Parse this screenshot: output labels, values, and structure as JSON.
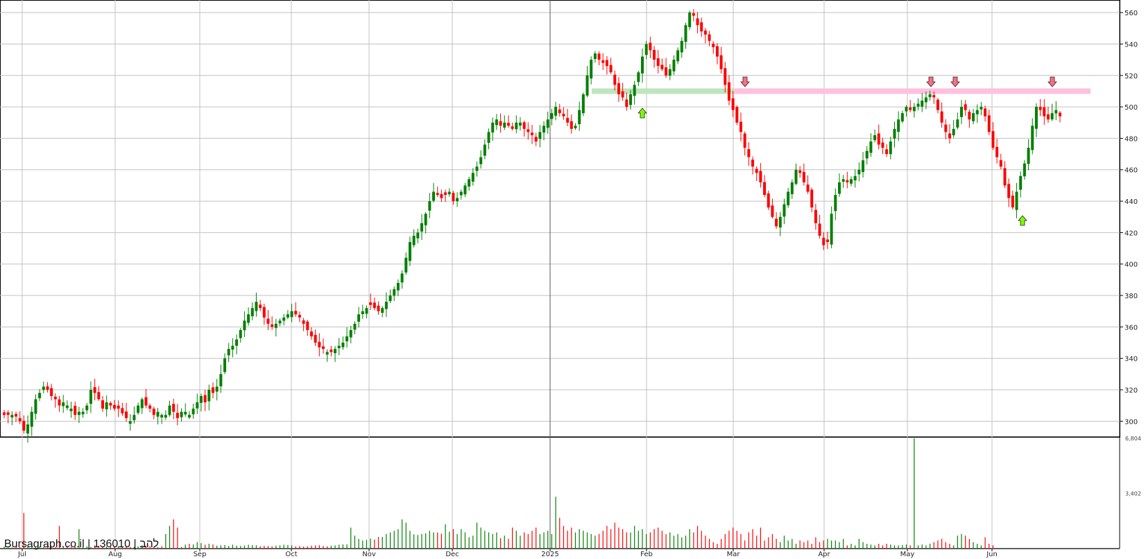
{
  "watermark": "Bursagraph.co.il | 136010 | להב",
  "colors": {
    "up": "#008000",
    "down": "#ff0000",
    "grid": "#c0c0c0",
    "support": "#bfe5bf",
    "resistance": "#ffc0e0",
    "up_arrow": "#7cfc00",
    "down_arrow": "#ff6e86"
  },
  "chart_data": [
    {
      "type": "candlestick",
      "title": "",
      "xlabel": "",
      "ylabel": "",
      "ylim": [
        290,
        568
      ],
      "y_ticks": [
        300,
        320,
        340,
        360,
        380,
        400,
        420,
        440,
        460,
        480,
        500,
        520,
        540,
        560
      ],
      "x_tick_labels": [
        "Jul",
        "Aug",
        "Sep",
        "Oct",
        "Nov",
        "Dec",
        "2025",
        "Feb",
        "Mar",
        "Apr",
        "May",
        "Jun"
      ],
      "grid": true,
      "closes": [
        304,
        304,
        304,
        303,
        300,
        294,
        298,
        306,
        314,
        318,
        322,
        320,
        316,
        314,
        310,
        312,
        310,
        308,
        304,
        306,
        306,
        310,
        320,
        318,
        314,
        308,
        312,
        310,
        308,
        308,
        305,
        302,
        300,
        304,
        310,
        314,
        310,
        308,
        304,
        306,
        304,
        304,
        310,
        306,
        302,
        306,
        306,
        304,
        308,
        312,
        316,
        312,
        320,
        318,
        322,
        330,
        340,
        346,
        348,
        352,
        358,
        364,
        368,
        372,
        376,
        372,
        366,
        362,
        360,
        362,
        364,
        366,
        368,
        370,
        368,
        366,
        362,
        358,
        354,
        350,
        347,
        346,
        344,
        344,
        346,
        348,
        350,
        354,
        358,
        362,
        368,
        370,
        372,
        374,
        372,
        370,
        372,
        376,
        380,
        384,
        388,
        394,
        404,
        414,
        418,
        420,
        426,
        432,
        440,
        446,
        444,
        442,
        444,
        446,
        440,
        442,
        446,
        450,
        454,
        458,
        462,
        468,
        476,
        484,
        490,
        492,
        488,
        490,
        488,
        486,
        490,
        490,
        486,
        484,
        482,
        478,
        484,
        488,
        492,
        496,
        500,
        496,
        494,
        490,
        486,
        488,
        498,
        508,
        520,
        530,
        534,
        530,
        528,
        526,
        522,
        514,
        508,
        506,
        500,
        508,
        514,
        522,
        532,
        540,
        536,
        530,
        526,
        524,
        520,
        524,
        530,
        536,
        542,
        552,
        560,
        558,
        552,
        548,
        546,
        542,
        538,
        532,
        524,
        514,
        504,
        498,
        490,
        484,
        474,
        468,
        462,
        458,
        452,
        444,
        436,
        430,
        424,
        430,
        438,
        446,
        452,
        460,
        458,
        452,
        446,
        436,
        426,
        418,
        412,
        414,
        432,
        444,
        452,
        454,
        452,
        454,
        456,
        460,
        466,
        472,
        478,
        482,
        476,
        474,
        470,
        478,
        486,
        492,
        496,
        500,
        498,
        500,
        502,
        504,
        506,
        508,
        506,
        498,
        490,
        484,
        480,
        486,
        492,
        500,
        498,
        492,
        496,
        498,
        500,
        494,
        484,
        474,
        468,
        462,
        450,
        442,
        436,
        446,
        456,
        464,
        474,
        488,
        500,
        498,
        494,
        492,
        496,
        498,
        494
      ],
      "volumes": [
        120,
        80,
        60,
        100,
        90,
        2200,
        130,
        110,
        80,
        140,
        90,
        150,
        110,
        100,
        1400,
        120,
        160,
        100,
        130,
        1200,
        90,
        140,
        110,
        200,
        180,
        150,
        130,
        110,
        90,
        150,
        130,
        120,
        110,
        100,
        140,
        200,
        180,
        160,
        120,
        100,
        150,
        900,
        1400,
        1800,
        1300,
        100,
        250,
        300,
        260,
        400,
        340,
        240,
        300,
        260,
        180,
        200,
        220,
        170,
        240,
        180,
        160,
        190,
        240,
        220,
        200,
        150,
        170,
        160,
        140,
        180,
        200,
        240,
        220,
        200,
        140,
        160,
        120,
        140,
        180,
        200,
        210,
        160,
        140,
        180,
        200,
        240,
        260,
        260,
        1300,
        800,
        600,
        500,
        540,
        620,
        560,
        720,
        720,
        900,
        1000,
        1100,
        1200,
        1800,
        1600,
        1100,
        880,
        840,
        900,
        940,
        1100,
        1000,
        1000,
        920,
        1500,
        1040,
        1200,
        900,
        1200,
        1000,
        700,
        800,
        1600,
        1300,
        1100,
        1000,
        900,
        1000,
        640,
        800,
        600,
        1300,
        1100,
        800,
        1000,
        900,
        1100,
        1300,
        900,
        1000,
        1100,
        900,
        3200,
        1900,
        1400,
        1100,
        1300,
        1000,
        1200,
        1100,
        1000,
        900,
        800,
        900,
        1100,
        1400,
        1200,
        1600,
        1300,
        1200,
        1000,
        1000,
        1400,
        1100,
        1200,
        900,
        1000,
        1200,
        1300,
        1100,
        900,
        1000,
        800,
        900,
        700,
        800,
        1200,
        1000,
        1400,
        1100,
        800,
        600,
        400,
        300,
        600,
        900,
        1100,
        1300,
        1100,
        900,
        500,
        1000,
        1200,
        800,
        1300,
        500,
        700,
        900,
        600,
        400,
        800,
        500,
        600,
        300,
        500,
        400,
        500,
        300,
        700,
        400,
        500,
        600,
        500,
        500,
        400,
        600,
        200,
        300,
        200,
        600,
        400,
        300,
        250,
        200,
        300,
        200,
        300,
        250,
        200,
        200,
        220,
        250,
        200,
        6804,
        200,
        250,
        200,
        300,
        400,
        500,
        600,
        400,
        300,
        200,
        800,
        900,
        800,
        600,
        400,
        300,
        200,
        700,
        300,
        200
      ],
      "volume_axis": {
        "ticks": [
          "3,402",
          "6,804"
        ],
        "max": 6804
      },
      "support_zone": {
        "level": 510,
        "from": "Jan",
        "to": "Mar"
      },
      "resistance_zone": {
        "level": 510,
        "from": "Mar",
        "to": "Jun"
      },
      "signals": [
        {
          "kind": "buy",
          "label": "up-arrow"
        },
        {
          "kind": "sell",
          "label": "down-arrow"
        },
        {
          "kind": "sell",
          "label": "down-arrow"
        },
        {
          "kind": "sell",
          "label": "down-arrow"
        },
        {
          "kind": "buy",
          "label": "up-arrow"
        },
        {
          "kind": "sell",
          "label": "down-arrow"
        }
      ]
    }
  ]
}
